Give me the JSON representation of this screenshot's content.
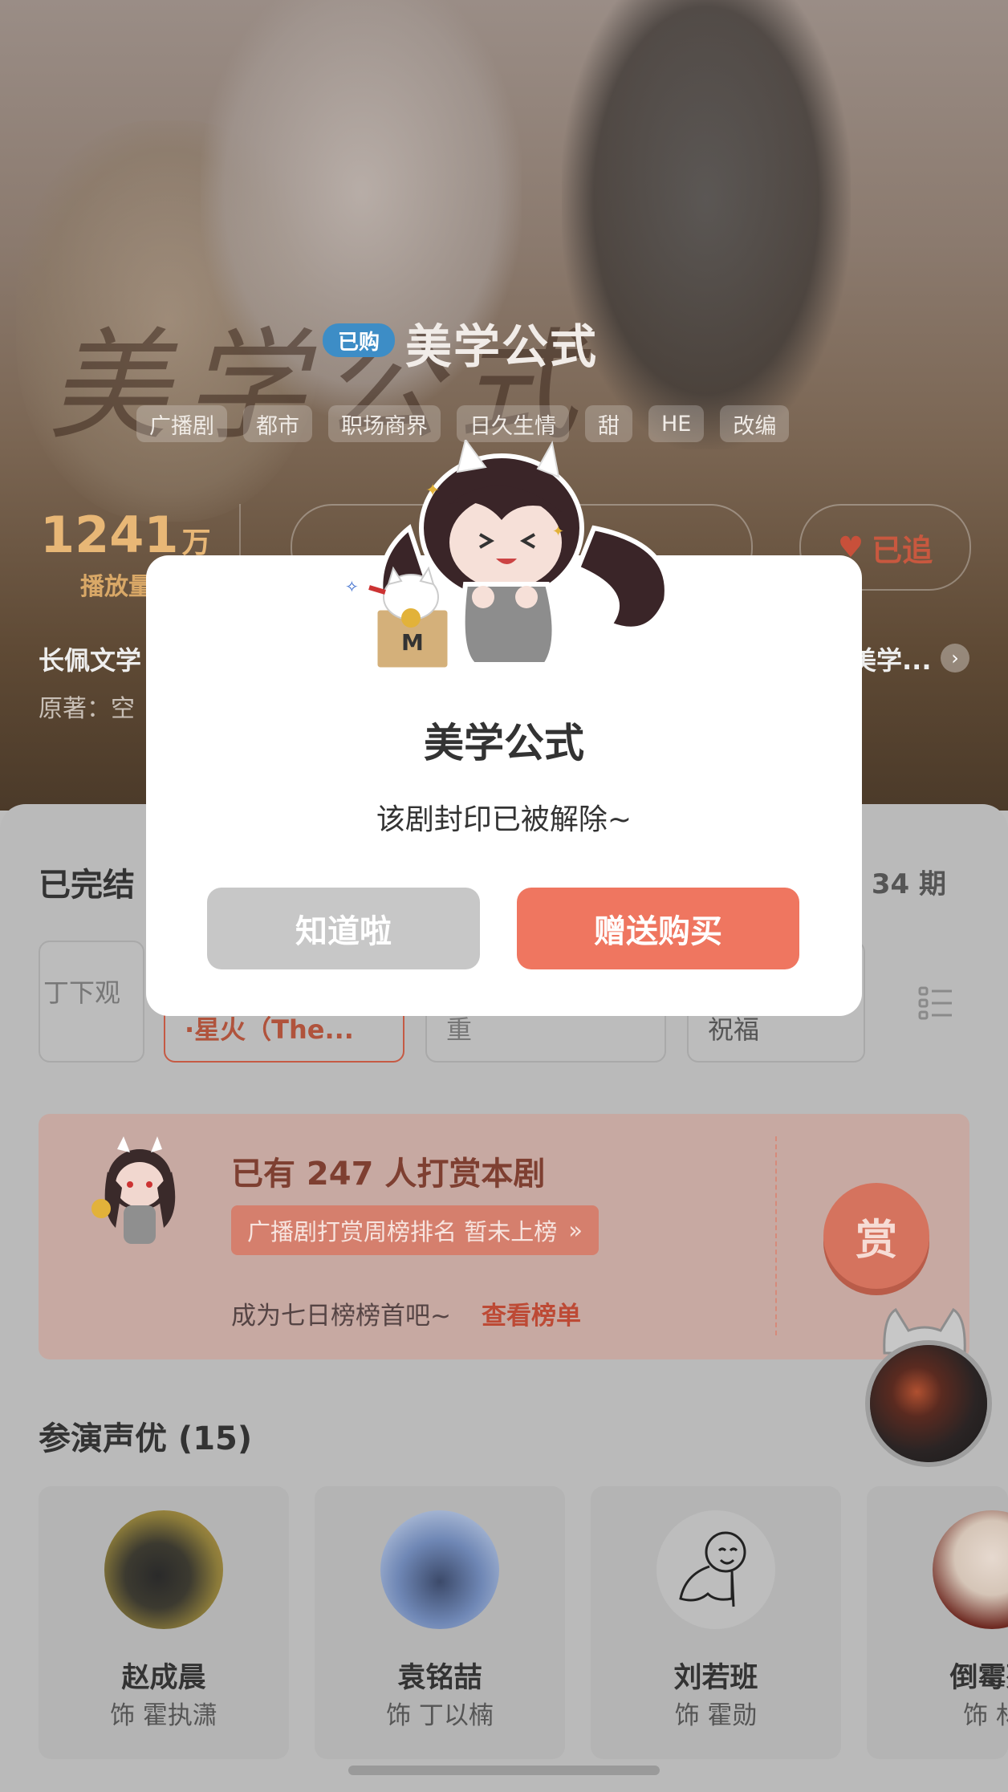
{
  "header": {
    "purchased_badge": "已购",
    "title": "美学公式",
    "tags": [
      "广播剧",
      "都市",
      "职场商界",
      "日久生情",
      "甜",
      "HE",
      "改编"
    ],
    "plays_value": "1241",
    "plays_unit": "万",
    "plays_label": "播放量",
    "follow_label": "已追",
    "author": "长佩文学",
    "original_label": "原著：空",
    "author_right": "美学..."
  },
  "episodes": {
    "status": "已完结",
    "total": "共 34 期",
    "items": [
      {
        "title": "丁下观"
      },
      {
        "title": "·星火（The..."
      },
      {
        "title": "重"
      },
      {
        "title": "祝福"
      }
    ]
  },
  "reward": {
    "count_text": "已有 247 人打赏本剧",
    "rank_text": "广播剧打赏周榜排名 暂未上榜",
    "sub_text": "成为七日榜榜首吧~",
    "link_text": "查看榜单",
    "button": "赏"
  },
  "cast": {
    "title": "参演声优 (15)",
    "members": [
      {
        "name": "赵成晨",
        "role": "饰 霍执潇"
      },
      {
        "name": "袁铭喆",
        "role": "饰 丁以楠"
      },
      {
        "name": "刘若班",
        "role": "饰 霍勋"
      },
      {
        "name": "倒霉死",
        "role": "饰 林"
      }
    ]
  },
  "dialog": {
    "title": "美学公式",
    "message": "该剧封印已被解除~",
    "ok_label": "知道啦",
    "gift_label": "赠送购买"
  },
  "colors": {
    "accent": "#ef7660",
    "badge_blue": "#3d8dc6",
    "plays_gold": "#e8b776"
  },
  "icons": [
    "heart-icon",
    "chevron-right-icon",
    "list-icon",
    "double-chevron-icon",
    "reward-mascot",
    "dialog-mascot"
  ]
}
